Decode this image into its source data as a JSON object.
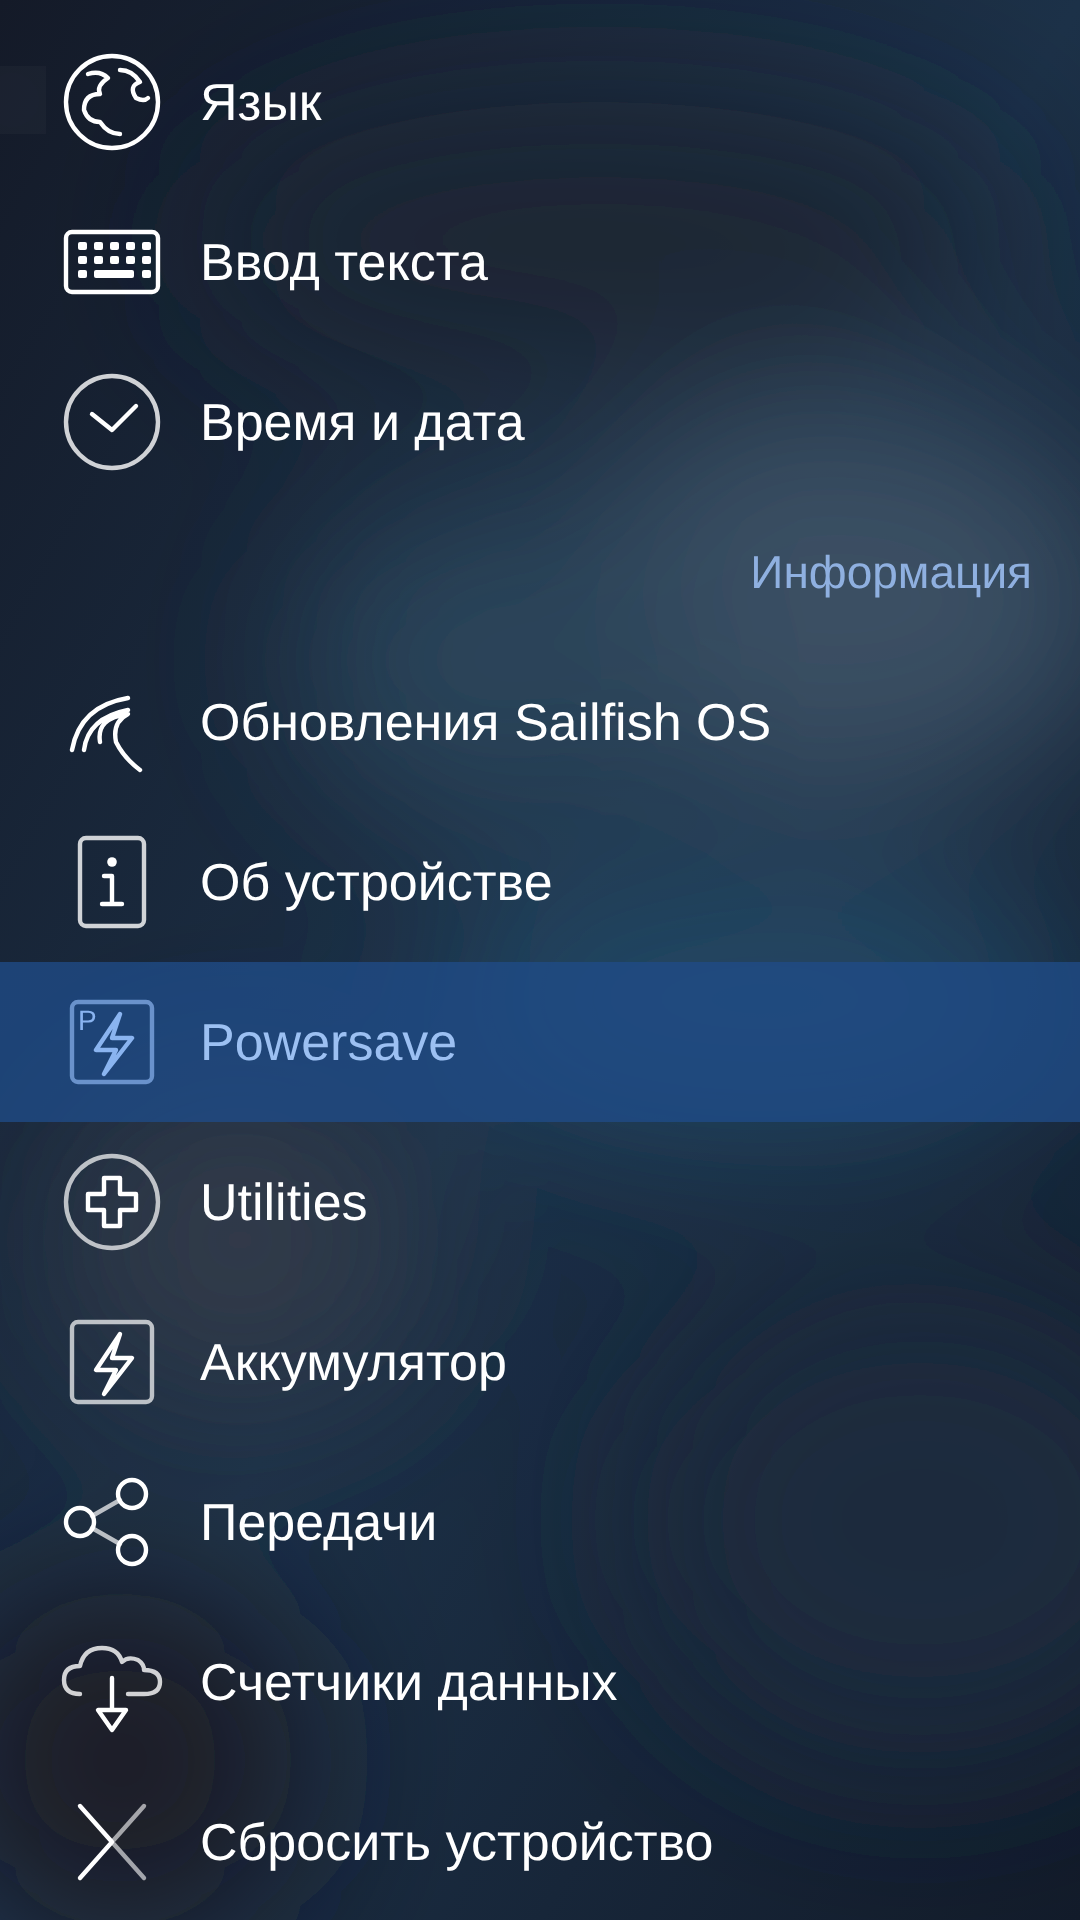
{
  "items": [
    {
      "kind": "item",
      "label": "Язык",
      "selected": false
    },
    {
      "kind": "item",
      "label": "Ввод текста",
      "selected": false
    },
    {
      "kind": "item",
      "label": "Время и дата",
      "selected": false
    },
    {
      "kind": "header",
      "label": "Информация"
    },
    {
      "kind": "item",
      "label": "Обновления Sailfish OS",
      "selected": false
    },
    {
      "kind": "item",
      "label": "Об устройстве",
      "selected": false
    },
    {
      "kind": "item",
      "icon_letter": "P",
      "label": "Powersave",
      "selected": true
    },
    {
      "kind": "item",
      "label": "Utilities",
      "selected": false
    },
    {
      "kind": "item",
      "label": "Аккумулятор",
      "selected": false
    },
    {
      "kind": "item",
      "label": "Передачи",
      "selected": false
    },
    {
      "kind": "item",
      "label": "Счетчики данных",
      "selected": false
    },
    {
      "kind": "item",
      "label": "Сбросить устройство",
      "selected": false
    }
  ]
}
